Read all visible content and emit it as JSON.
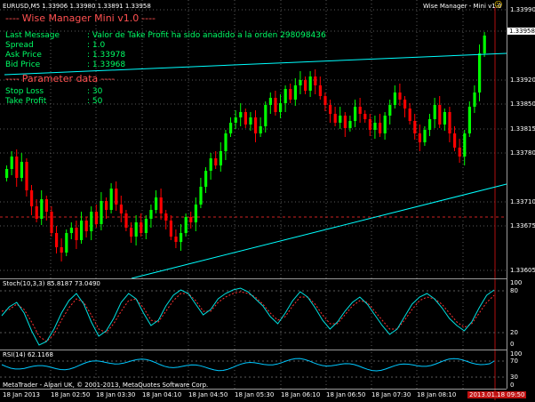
{
  "window": {
    "symbol_line": "EURUSD,M5  1.33906 1.33980 1.33891 1.33958",
    "indicator_title": "Wise Manager - Mini v1.0",
    "indicator_title_icon": "smiley-icon"
  },
  "panel": {
    "header": "Wise Manager Mini v1.0",
    "rows": [
      {
        "label": "Last Message",
        "value": "Valor de Take Profit ha sido anadido a la orden 298098436"
      },
      {
        "label": "Spread",
        "value": "1.0"
      },
      {
        "label": "Ask Price",
        "value": "1.33978"
      },
      {
        "label": "Bid Price",
        "value": "1.33968"
      }
    ],
    "param_header": "Parameter data",
    "params": [
      {
        "label": "Stop Loss",
        "value": "30"
      },
      {
        "label": "Take Profit",
        "value": "50"
      }
    ]
  },
  "price_axis": {
    "ticks": [
      "1.33990",
      "1.33958",
      "1.33920",
      "1.33850",
      "1.33815",
      "1.33780",
      "1.33710",
      "1.33675",
      "1.33605"
    ],
    "current_price": "1.33958"
  },
  "stoch": {
    "label": "Stoch(10,3,3) 85.8187 73.0490",
    "ticks": [
      "100",
      "80",
      "20",
      "0"
    ]
  },
  "rsi": {
    "label": "RSI(14) 62.1168",
    "ticks": [
      "100",
      "70",
      "30",
      "0"
    ]
  },
  "footer": {
    "copyright": "MetaTrader - Alpari UK, © 2001-2013, MetaQuotes Software Corp.",
    "time_ticks": [
      "18 Jan 2013",
      "18 Jan 02:50",
      "18 Jan 03:30",
      "18 Jan 04:10",
      "18 Jan 04:50",
      "18 Jan 05:30",
      "18 Jan 06:10",
      "18 Jan 06:50",
      "18 Jan 07:30",
      "18 Jan 08:10",
      "18 Jan 08:50"
    ],
    "current_time": "2013.01.18 09:50"
  },
  "colors": {
    "bull": "#00ff00",
    "bear": "#ff0000",
    "trendline": "#00ffff",
    "grid": "#5a5a5a",
    "stoch_main": "#00ffff",
    "stoch_signal": "#ff0000"
  }
}
